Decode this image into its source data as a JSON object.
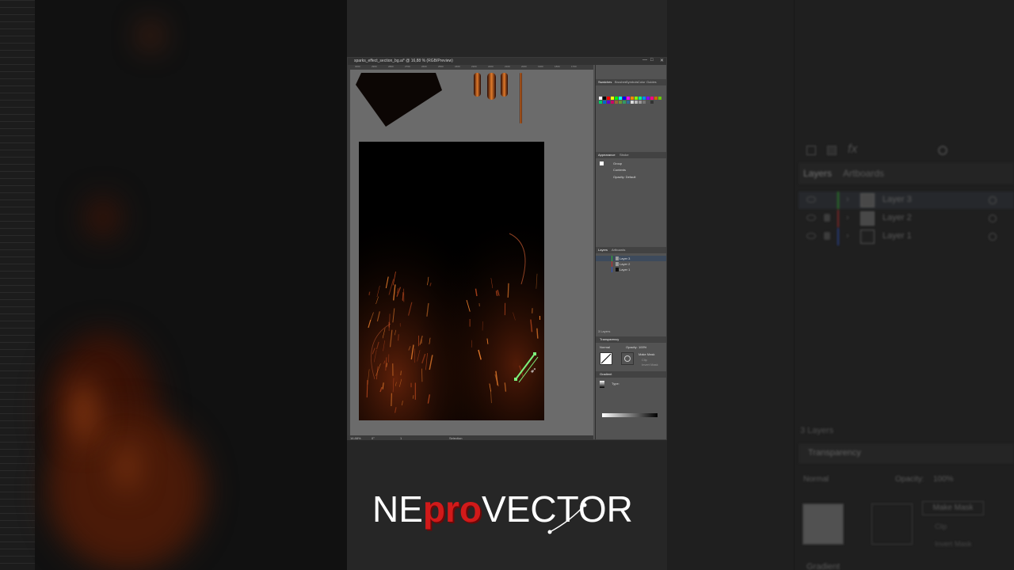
{
  "window": {
    "title": "sparks_effect_section_bg.ai* @ 16,88 % (RGB/Preview)",
    "controls": [
      "—",
      "□",
      "✕"
    ]
  },
  "ruler_ticks": [
    "3000",
    "2900",
    "2800",
    "2700",
    "2600",
    "2500",
    "2400",
    "2300",
    "2200",
    "2100",
    "2000",
    "1900",
    "1800",
    "1700"
  ],
  "statusbar": {
    "zoom": "16,88%",
    "rotation": "0°",
    "artboard": "1",
    "tool": "Selection"
  },
  "panels": {
    "swatches_tabs": [
      "Swatches",
      "Brushes",
      "Symbols",
      "Color",
      "Guides"
    ],
    "appearance": {
      "tabs": [
        "Appearance",
        "Stroke"
      ],
      "rows": [
        "Group",
        "Contents",
        "Opacity: Default"
      ]
    },
    "layers": {
      "tabs": [
        "Layers",
        "Artboards"
      ],
      "items": [
        {
          "name": "Layer 3",
          "color": "#2fb52f",
          "selected": true,
          "locked": false
        },
        {
          "name": "Layer 2",
          "color": "#c22f2f",
          "selected": false,
          "locked": true
        },
        {
          "name": "Layer 1",
          "color": "#2f52c2",
          "selected": false,
          "locked": true
        }
      ],
      "count": "3 Layers"
    },
    "transparency": {
      "title": "Transparency",
      "blend_mode": "Normal",
      "opacity_label": "Opacity:",
      "opacity_value": "100%",
      "make_mask": "Make Mask",
      "clip": "Clip",
      "invert_mask": "Invert Mask"
    },
    "gradient": {
      "title": "Gradient",
      "type_label": "Type:"
    }
  },
  "backdrop_right": {
    "tabs": [
      "Layers",
      "Artboards"
    ],
    "layers": [
      "Layer 3",
      "Layer 2",
      "Layer 1"
    ],
    "count": "3 Layers",
    "transparency_title": "Transparency",
    "blend_mode": "Normal",
    "opacity_label": "Opacity:",
    "opacity_value": "100%",
    "make_mask": "Make Mask",
    "clip": "Clip",
    "invert_mask": "Invert Mask",
    "gradient_title": "Gradient"
  },
  "brand": {
    "part1": "NE",
    "part2": "pro",
    "part3": "VECTOR",
    "accent": "#d11a1a"
  }
}
